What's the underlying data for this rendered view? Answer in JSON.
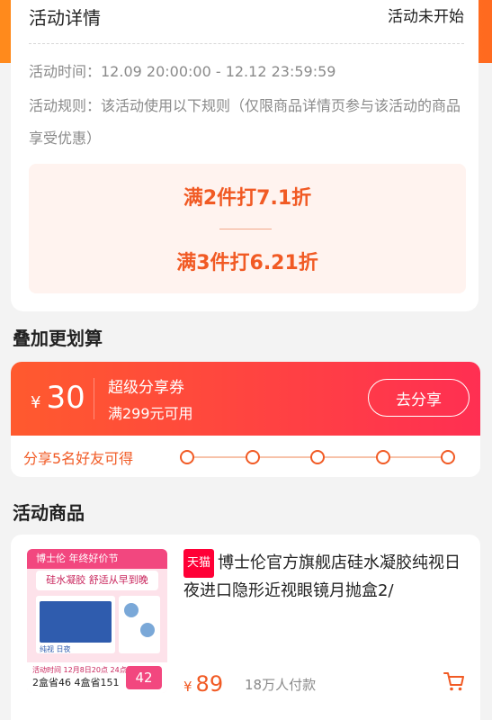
{
  "colors": {
    "accent": "#f15a24",
    "brand": "#ff8a1c",
    "coupon_gradient_start": "#ff5a2e",
    "coupon_gradient_end": "#ff2f52"
  },
  "detail": {
    "title": "活动详情",
    "status": "活动未开始",
    "time": "活动时间：12.09 20:00:00 - 12.12 23:59:59",
    "rule": "活动规则：该活动使用以下规则（仅限商品详情页参与该活动的商品享受优惠）",
    "tiers": [
      "满2件打7.1折",
      "满3件打6.21折"
    ]
  },
  "stack_section": {
    "title": "叠加更划算"
  },
  "coupon": {
    "currency": "¥",
    "amount": "30",
    "name": "超级分享券",
    "condition": "满299元可用",
    "button": "去分享",
    "share_label": "分享5名好友可得",
    "progress_total": 5,
    "progress_done": 0
  },
  "products_section": {
    "title": "活动商品"
  },
  "product": {
    "badge": "天猫",
    "title": "博士伦官方旗舰店硅水凝胶纯视日夜进口隐形近视眼镜月抛盒2/",
    "currency": "¥",
    "price": "89",
    "sales": "18万人付款",
    "image": {
      "header": "博士伦  年终好价节",
      "title": "硅水凝胶 舒适从早到晚",
      "box_label": "纯视 日夜",
      "footer_a": "活动时间 12月8日20点 24点前",
      "footer_b": "2盒省46  4盒省151",
      "footer_badge": "42"
    },
    "icon": "cart-icon"
  }
}
